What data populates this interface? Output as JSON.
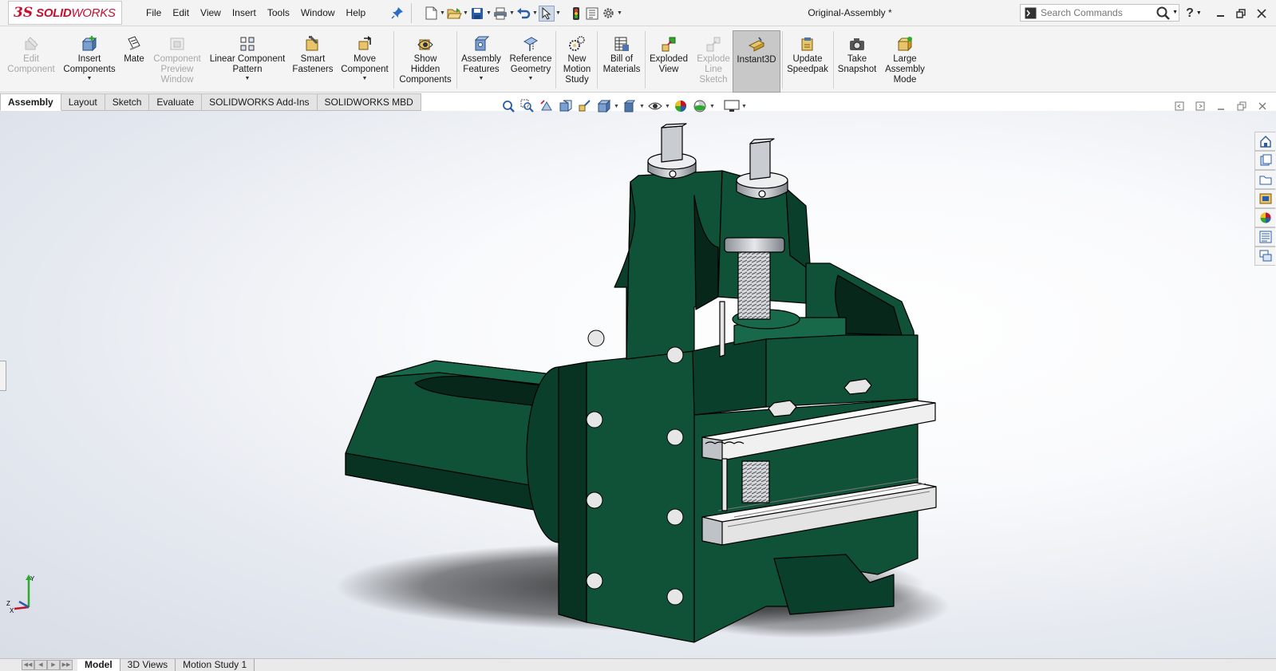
{
  "app": {
    "logo_ds": "3S",
    "logo_name_bold": "SOLID",
    "logo_name_light": "WORKS",
    "document_title": "Original-Assembly *"
  },
  "menu": [
    "File",
    "Edit",
    "View",
    "Insert",
    "Tools",
    "Window",
    "Help"
  ],
  "search": {
    "placeholder": "Search Commands"
  },
  "commands": [
    {
      "label": "Edit\nComponent",
      "icon": "edit-component-icon",
      "enabled": false,
      "dropdown": false
    },
    {
      "label": "Insert\nComponents",
      "icon": "insert-components-icon",
      "enabled": true,
      "dropdown": true
    },
    {
      "label": "Mate",
      "icon": "mate-icon",
      "enabled": true,
      "dropdown": false
    },
    {
      "label": "Component\nPreview\nWindow",
      "icon": "component-preview-icon",
      "enabled": false,
      "dropdown": false
    },
    {
      "label": "Linear Component\nPattern",
      "icon": "linear-pattern-icon",
      "enabled": true,
      "dropdown": true
    },
    {
      "label": "Smart\nFasteners",
      "icon": "smart-fasteners-icon",
      "enabled": true,
      "dropdown": false
    },
    {
      "label": "Move\nComponent",
      "icon": "move-component-icon",
      "enabled": true,
      "dropdown": true
    },
    {
      "label": "Show\nHidden\nComponents",
      "icon": "show-hidden-icon",
      "enabled": true,
      "dropdown": false
    },
    {
      "label": "Assembly\nFeatures",
      "icon": "assembly-features-icon",
      "enabled": true,
      "dropdown": true
    },
    {
      "label": "Reference\nGeometry",
      "icon": "reference-geometry-icon",
      "enabled": true,
      "dropdown": true
    },
    {
      "label": "New\nMotion\nStudy",
      "icon": "motion-study-icon",
      "enabled": true,
      "dropdown": false
    },
    {
      "label": "Bill of\nMaterials",
      "icon": "bill-of-materials-icon",
      "enabled": true,
      "dropdown": false
    },
    {
      "label": "Exploded\nView",
      "icon": "exploded-view-icon",
      "enabled": true,
      "dropdown": false
    },
    {
      "label": "Explode\nLine\nSketch",
      "icon": "explode-line-icon",
      "enabled": false,
      "dropdown": false
    },
    {
      "label": "Instant3D",
      "icon": "instant3d-icon",
      "enabled": true,
      "dropdown": false,
      "active": true
    },
    {
      "label": "Update\nSpeedpak",
      "icon": "speedpak-icon",
      "enabled": true,
      "dropdown": false
    },
    {
      "label": "Take\nSnapshot",
      "icon": "camera-icon",
      "enabled": true,
      "dropdown": false
    },
    {
      "label": "Large\nAssembly\nMode",
      "icon": "large-assembly-icon",
      "enabled": true,
      "dropdown": false
    }
  ],
  "tabs": [
    {
      "label": "Assembly",
      "active": true
    },
    {
      "label": "Layout",
      "active": false
    },
    {
      "label": "Sketch",
      "active": false
    },
    {
      "label": "Evaluate",
      "active": false
    },
    {
      "label": "SOLIDWORKS Add-Ins",
      "active": false
    },
    {
      "label": "SOLIDWORKS MBD",
      "active": false
    }
  ],
  "bottom_tabs": [
    {
      "label": "Model",
      "active": true
    },
    {
      "label": "3D Views",
      "active": false
    },
    {
      "label": "Motion Study 1",
      "active": false
    }
  ],
  "colors": {
    "model_green": "#0f5238",
    "model_green_dark": "#083222",
    "steel": "#c9ccd0",
    "accent_red": "#c8102e"
  }
}
